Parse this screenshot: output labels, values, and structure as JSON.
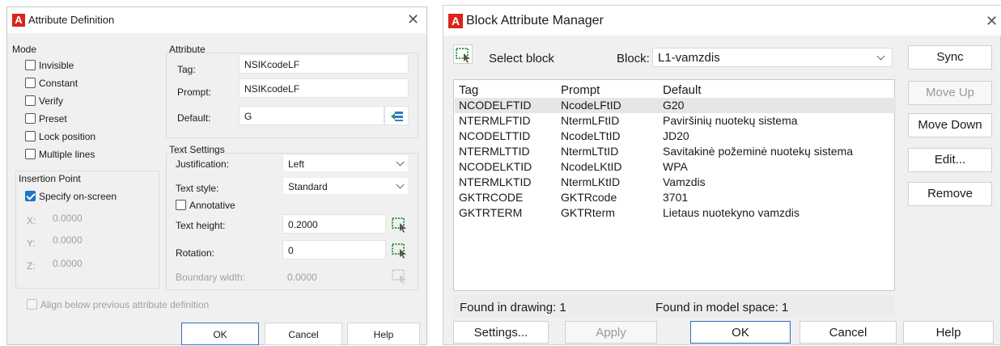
{
  "attr_dialog": {
    "title": "Attribute Definition",
    "close_glyph": "✕",
    "mode": {
      "heading": "Mode",
      "options": [
        {
          "label": "Invisible",
          "checked": false
        },
        {
          "label": "Constant",
          "checked": false
        },
        {
          "label": "Verify",
          "checked": false
        },
        {
          "label": "Preset",
          "checked": false
        },
        {
          "label": "Lock position",
          "checked": false
        },
        {
          "label": "Multiple lines",
          "checked": false
        }
      ]
    },
    "insertion": {
      "heading": "Insertion Point",
      "specify_label": "Specify on-screen",
      "specify_checked": true,
      "x_label": "X:",
      "x_value": "0.0000",
      "y_label": "Y:",
      "y_value": "0.0000",
      "z_label": "Z:",
      "z_value": "0.0000"
    },
    "attribute": {
      "heading": "Attribute",
      "tag_label": "Tag:",
      "tag_value": "NSIKcodeLF",
      "prompt_label": "Prompt:",
      "prompt_value": "NSIKcodeLF",
      "default_label": "Default:",
      "default_value": "G"
    },
    "text_settings": {
      "heading": "Text Settings",
      "justification_label": "Justification:",
      "justification_value": "Left",
      "style_label": "Text style:",
      "style_value": "Standard",
      "annotative_label": "Annotative",
      "height_label": "Text height:",
      "height_value": "0.2000",
      "rotation_label": "Rotation:",
      "rotation_value": "0",
      "boundary_label": "Boundary width:",
      "boundary_value": "0.0000"
    },
    "align_label": "Align below previous attribute definition",
    "buttons": {
      "ok": "OK",
      "cancel": "Cancel",
      "help": "Help"
    }
  },
  "bam_dialog": {
    "title": "Block Attribute Manager",
    "close_glyph": "✕",
    "select_block_label": "Select block",
    "block_label": "Block:",
    "block_value": "L1-vamzdis",
    "columns": [
      "Tag",
      "Prompt",
      "Default"
    ],
    "rows": [
      [
        "NCODELFTID",
        "NcodeLFtID",
        "G20"
      ],
      [
        "NTERMLFTID",
        "NtermLFtID",
        "Paviršinių nuotekų sistema"
      ],
      [
        "NCODELTTID",
        "NcodeLTtID",
        "JD20"
      ],
      [
        "NTERMLTTID",
        "NtermLTtID",
        "Savitakinė požeminė nuotekų sistema"
      ],
      [
        "NCODELKTID",
        "NcodeLKtID",
        "WPA"
      ],
      [
        "NTERMLKTID",
        "NtermLKtID",
        "Vamzdis"
      ],
      [
        "GKTRCODE",
        "GKTRcode",
        "3701"
      ],
      [
        "GKTRTERM",
        "GKTRterm",
        "Lietaus nuotekyno vamzdis"
      ]
    ],
    "found_in_drawing": "Found in drawing: 1",
    "found_in_model": "Found in model space: 1",
    "side_buttons": {
      "sync": "Sync",
      "move_up": "Move Up",
      "move_down": "Move Down",
      "edit": "Edit...",
      "remove": "Remove"
    },
    "bottom_buttons": {
      "settings": "Settings...",
      "apply": "Apply",
      "ok": "OK",
      "cancel": "Cancel",
      "help": "Help"
    }
  }
}
